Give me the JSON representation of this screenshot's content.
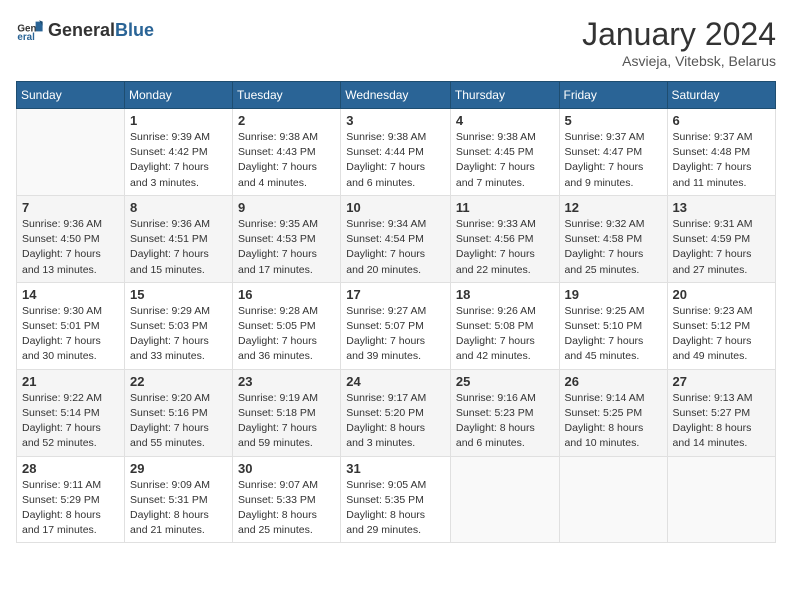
{
  "header": {
    "logo_general": "General",
    "logo_blue": "Blue",
    "month_title": "January 2024",
    "location": "Asvieja, Vitebsk, Belarus"
  },
  "weekdays": [
    "Sunday",
    "Monday",
    "Tuesday",
    "Wednesday",
    "Thursday",
    "Friday",
    "Saturday"
  ],
  "weeks": [
    [
      {
        "day": "",
        "info": ""
      },
      {
        "day": "1",
        "info": "Sunrise: 9:39 AM\nSunset: 4:42 PM\nDaylight: 7 hours\nand 3 minutes."
      },
      {
        "day": "2",
        "info": "Sunrise: 9:38 AM\nSunset: 4:43 PM\nDaylight: 7 hours\nand 4 minutes."
      },
      {
        "day": "3",
        "info": "Sunrise: 9:38 AM\nSunset: 4:44 PM\nDaylight: 7 hours\nand 6 minutes."
      },
      {
        "day": "4",
        "info": "Sunrise: 9:38 AM\nSunset: 4:45 PM\nDaylight: 7 hours\nand 7 minutes."
      },
      {
        "day": "5",
        "info": "Sunrise: 9:37 AM\nSunset: 4:47 PM\nDaylight: 7 hours\nand 9 minutes."
      },
      {
        "day": "6",
        "info": "Sunrise: 9:37 AM\nSunset: 4:48 PM\nDaylight: 7 hours\nand 11 minutes."
      }
    ],
    [
      {
        "day": "7",
        "info": "Sunrise: 9:36 AM\nSunset: 4:50 PM\nDaylight: 7 hours\nand 13 minutes."
      },
      {
        "day": "8",
        "info": "Sunrise: 9:36 AM\nSunset: 4:51 PM\nDaylight: 7 hours\nand 15 minutes."
      },
      {
        "day": "9",
        "info": "Sunrise: 9:35 AM\nSunset: 4:53 PM\nDaylight: 7 hours\nand 17 minutes."
      },
      {
        "day": "10",
        "info": "Sunrise: 9:34 AM\nSunset: 4:54 PM\nDaylight: 7 hours\nand 20 minutes."
      },
      {
        "day": "11",
        "info": "Sunrise: 9:33 AM\nSunset: 4:56 PM\nDaylight: 7 hours\nand 22 minutes."
      },
      {
        "day": "12",
        "info": "Sunrise: 9:32 AM\nSunset: 4:58 PM\nDaylight: 7 hours\nand 25 minutes."
      },
      {
        "day": "13",
        "info": "Sunrise: 9:31 AM\nSunset: 4:59 PM\nDaylight: 7 hours\nand 27 minutes."
      }
    ],
    [
      {
        "day": "14",
        "info": "Sunrise: 9:30 AM\nSunset: 5:01 PM\nDaylight: 7 hours\nand 30 minutes."
      },
      {
        "day": "15",
        "info": "Sunrise: 9:29 AM\nSunset: 5:03 PM\nDaylight: 7 hours\nand 33 minutes."
      },
      {
        "day": "16",
        "info": "Sunrise: 9:28 AM\nSunset: 5:05 PM\nDaylight: 7 hours\nand 36 minutes."
      },
      {
        "day": "17",
        "info": "Sunrise: 9:27 AM\nSunset: 5:07 PM\nDaylight: 7 hours\nand 39 minutes."
      },
      {
        "day": "18",
        "info": "Sunrise: 9:26 AM\nSunset: 5:08 PM\nDaylight: 7 hours\nand 42 minutes."
      },
      {
        "day": "19",
        "info": "Sunrise: 9:25 AM\nSunset: 5:10 PM\nDaylight: 7 hours\nand 45 minutes."
      },
      {
        "day": "20",
        "info": "Sunrise: 9:23 AM\nSunset: 5:12 PM\nDaylight: 7 hours\nand 49 minutes."
      }
    ],
    [
      {
        "day": "21",
        "info": "Sunrise: 9:22 AM\nSunset: 5:14 PM\nDaylight: 7 hours\nand 52 minutes."
      },
      {
        "day": "22",
        "info": "Sunrise: 9:20 AM\nSunset: 5:16 PM\nDaylight: 7 hours\nand 55 minutes."
      },
      {
        "day": "23",
        "info": "Sunrise: 9:19 AM\nSunset: 5:18 PM\nDaylight: 7 hours\nand 59 minutes."
      },
      {
        "day": "24",
        "info": "Sunrise: 9:17 AM\nSunset: 5:20 PM\nDaylight: 8 hours\nand 3 minutes."
      },
      {
        "day": "25",
        "info": "Sunrise: 9:16 AM\nSunset: 5:23 PM\nDaylight: 8 hours\nand 6 minutes."
      },
      {
        "day": "26",
        "info": "Sunrise: 9:14 AM\nSunset: 5:25 PM\nDaylight: 8 hours\nand 10 minutes."
      },
      {
        "day": "27",
        "info": "Sunrise: 9:13 AM\nSunset: 5:27 PM\nDaylight: 8 hours\nand 14 minutes."
      }
    ],
    [
      {
        "day": "28",
        "info": "Sunrise: 9:11 AM\nSunset: 5:29 PM\nDaylight: 8 hours\nand 17 minutes."
      },
      {
        "day": "29",
        "info": "Sunrise: 9:09 AM\nSunset: 5:31 PM\nDaylight: 8 hours\nand 21 minutes."
      },
      {
        "day": "30",
        "info": "Sunrise: 9:07 AM\nSunset: 5:33 PM\nDaylight: 8 hours\nand 25 minutes."
      },
      {
        "day": "31",
        "info": "Sunrise: 9:05 AM\nSunset: 5:35 PM\nDaylight: 8 hours\nand 29 minutes."
      },
      {
        "day": "",
        "info": ""
      },
      {
        "day": "",
        "info": ""
      },
      {
        "day": "",
        "info": ""
      }
    ]
  ]
}
